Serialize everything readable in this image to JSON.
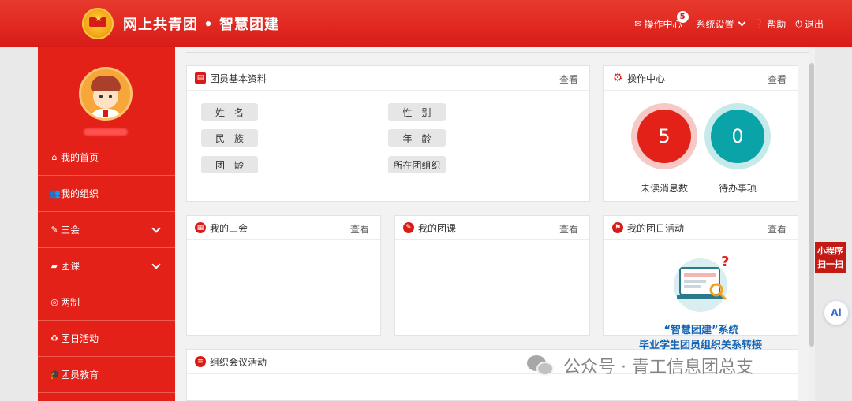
{
  "header": {
    "title": "网上共青团 • 智慧团建",
    "nav": [
      {
        "label": "操作中心",
        "icon": "mail-icon",
        "badge": "5"
      },
      {
        "label": "系统设置",
        "icon": "",
        "caret": true
      },
      {
        "label": "帮助",
        "icon": "help-icon"
      },
      {
        "label": "退出",
        "icon": "power-icon"
      }
    ]
  },
  "sidebar": {
    "menu": [
      {
        "label": "我的首页",
        "icon": "home-icon"
      },
      {
        "label": "我的组织",
        "icon": "users-icon"
      },
      {
        "label": "三会",
        "icon": "edit-icon",
        "expandable": true
      },
      {
        "label": "团课",
        "icon": "folder-icon",
        "expandable": true
      },
      {
        "label": "两制",
        "icon": "target-icon"
      },
      {
        "label": "团日活动",
        "icon": "recycle-icon"
      },
      {
        "label": "团员教育",
        "icon": "graduation-cap-icon"
      }
    ]
  },
  "panels": {
    "profile": {
      "title": "团员基本资料",
      "view": "查看",
      "fields": [
        "姓　名",
        "性　别",
        "民　族",
        "年　龄",
        "团　龄",
        "所在团组织"
      ]
    },
    "ops": {
      "title": "操作中心",
      "view": "查看",
      "unread_count": "5",
      "unread_label": "未读消息数",
      "todo_count": "0",
      "todo_label": "待办事项"
    },
    "sanhui": {
      "title": "我的三会",
      "view": "查看"
    },
    "tuanke": {
      "title": "我的团课",
      "view": "查看"
    },
    "tuanri": {
      "title": "我的团日活动",
      "view": "查看",
      "promo_title": "“智慧团建”系统",
      "promo_sub": "毕业学生团员组织关系转接"
    },
    "meeting": {
      "title": "组织会议活动"
    }
  },
  "side_tools": {
    "mini_program": [
      "小程序",
      "扫一扫"
    ],
    "ai": "Ai"
  },
  "watermark": "公众号 · 青工信息团总支",
  "colors": {
    "brand_red": "#d91b17",
    "sidebar_red": "#e32119",
    "teal": "#0aa3a8",
    "promo_blue": "#1464b4"
  }
}
